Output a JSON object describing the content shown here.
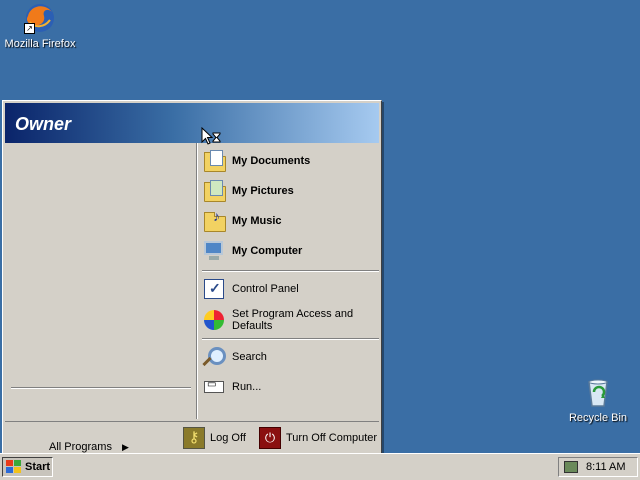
{
  "desktop": {
    "background": "#3a6ea5",
    "icons": [
      {
        "label": "Mozilla Firefox",
        "icon": "firefox-icon"
      },
      {
        "label": "Recycle Bin",
        "icon": "recycle-bin-icon"
      }
    ]
  },
  "start_menu": {
    "user_name": "Owner",
    "right_items": [
      {
        "label": "My Documents",
        "icon": "my-documents-icon",
        "bold": true
      },
      {
        "label": "My Pictures",
        "icon": "my-pictures-icon",
        "bold": true
      },
      {
        "label": "My Music",
        "icon": "my-music-icon",
        "bold": true
      },
      {
        "label": "My Computer",
        "icon": "my-computer-icon",
        "bold": true
      },
      {
        "label": "Control Panel",
        "icon": "control-panel-icon",
        "bold": false
      },
      {
        "label": "Set Program Access and Defaults",
        "icon": "program-access-icon",
        "bold": false
      },
      {
        "label": "Search",
        "icon": "search-icon",
        "bold": false
      },
      {
        "label": "Run...",
        "icon": "run-icon",
        "bold": false
      }
    ],
    "all_programs": "All Programs",
    "footer": {
      "log_off": "Log Off",
      "turn_off": "Turn Off Computer"
    }
  },
  "taskbar": {
    "start_label": "Start",
    "clock": "8:11 AM"
  }
}
